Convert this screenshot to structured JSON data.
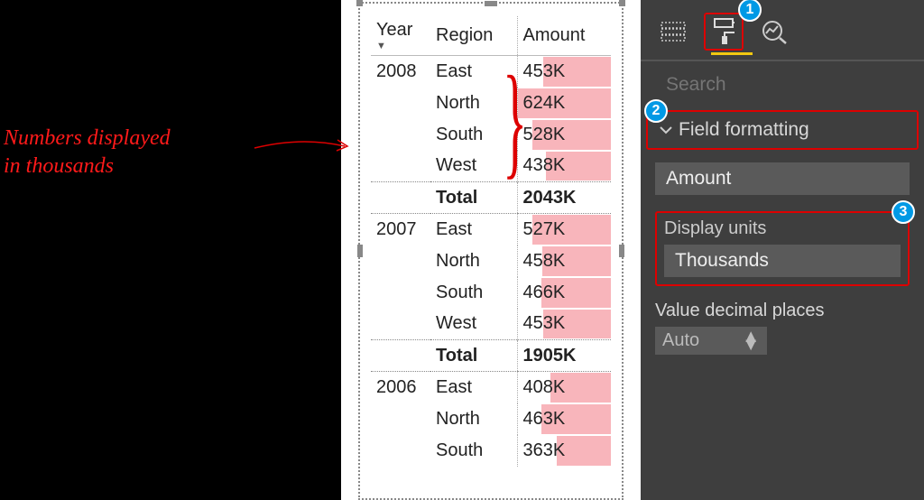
{
  "annotation": {
    "line1": "Numbers displayed",
    "line2": "in thousands"
  },
  "table": {
    "columns": {
      "year": "Year",
      "region": "Region",
      "amount": "Amount"
    },
    "total_label": "Total",
    "groups": [
      {
        "year": "2008",
        "rows": [
          {
            "region": "East",
            "amount": "453K",
            "bar": 72
          },
          {
            "region": "North",
            "amount": "624K",
            "bar": 100
          },
          {
            "region": "South",
            "amount": "528K",
            "bar": 84
          },
          {
            "region": "West",
            "amount": "438K",
            "bar": 70
          }
        ],
        "total": "2043K"
      },
      {
        "year": "2007",
        "rows": [
          {
            "region": "East",
            "amount": "527K",
            "bar": 84
          },
          {
            "region": "North",
            "amount": "458K",
            "bar": 73
          },
          {
            "region": "South",
            "amount": "466K",
            "bar": 74
          },
          {
            "region": "West",
            "amount": "453K",
            "bar": 72
          }
        ],
        "total": "1905K"
      },
      {
        "year": "2006",
        "rows": [
          {
            "region": "East",
            "amount": "408K",
            "bar": 65
          },
          {
            "region": "North",
            "amount": "463K",
            "bar": 74
          },
          {
            "region": "South",
            "amount": "363K",
            "bar": 58
          }
        ],
        "total": ""
      }
    ]
  },
  "format_pane": {
    "search_placeholder": "Search",
    "section": "Field formatting",
    "field_selected": "Amount",
    "display_units_label": "Display units",
    "display_units_value": "Thousands",
    "decimal_label": "Value decimal places",
    "decimal_value": "Auto",
    "callouts": {
      "one": "1",
      "two": "2",
      "three": "3"
    }
  }
}
